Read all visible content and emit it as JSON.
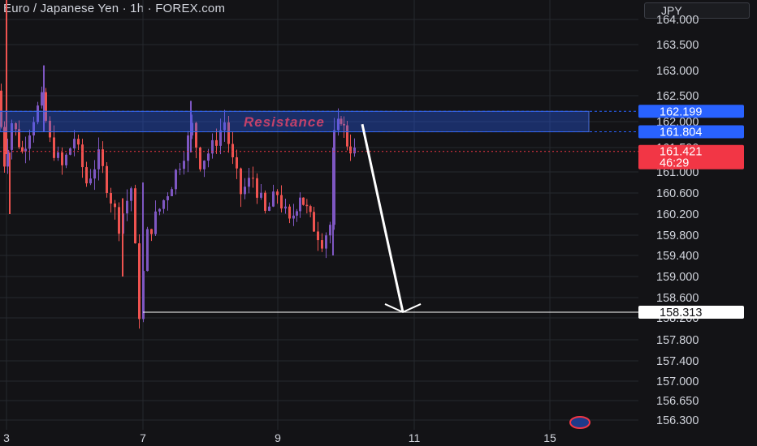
{
  "header": {
    "title": "Euro / Japanese Yen · 1h · FOREX.com",
    "currency_button": "JPY"
  },
  "colors": {
    "background": "#131316",
    "grid": "#26282e",
    "candle_up": "#7e57c2",
    "candle_down": "#ef5350",
    "resistance_zone": "#2962ff",
    "resistance_text": "#c2416a",
    "current_price": "#f23645",
    "target_line": "#ffffff"
  },
  "chart_data": {
    "type": "candlestick",
    "symbol": "EURJPY",
    "timeframe": "1h",
    "y_axis": {
      "ticks": [
        "164.000",
        "163.500",
        "163.000",
        "162.500",
        "162.000",
        "161.500",
        "161.000",
        "160.600",
        "160.200",
        "159.800",
        "159.400",
        "159.000",
        "158.600",
        "158.200",
        "157.800",
        "157.400",
        "157.000",
        "156.650",
        "156.300"
      ]
    },
    "x_axis": {
      "ticks": [
        "3",
        "7",
        "9",
        "11",
        "15"
      ]
    },
    "resistance_zone": {
      "label": "Resistance",
      "upper": 162.199,
      "lower": 161.804
    },
    "current_price": {
      "value": "161.421",
      "countdown": "46:29"
    },
    "target": {
      "value": "158.313"
    },
    "series_path": [
      [
        0,
        162.6
      ],
      [
        8,
        161.2
      ],
      [
        18,
        162.0
      ],
      [
        30,
        161.4
      ],
      [
        45,
        162.1
      ],
      [
        55,
        162.4
      ],
      [
        65,
        161.6
      ],
      [
        80,
        161.1
      ],
      [
        95,
        161.7
      ],
      [
        110,
        160.8
      ],
      [
        125,
        161.3
      ],
      [
        140,
        160.5
      ],
      [
        150,
        160.0
      ],
      [
        165,
        160.7
      ],
      [
        175,
        158.3
      ],
      [
        185,
        159.8
      ],
      [
        200,
        160.3
      ],
      [
        215,
        160.8
      ],
      [
        230,
        161.4
      ],
      [
        240,
        161.9
      ],
      [
        250,
        161.2
      ],
      [
        265,
        161.5
      ],
      [
        280,
        162.0
      ],
      [
        290,
        161.2
      ],
      [
        300,
        160.6
      ],
      [
        315,
        160.9
      ],
      [
        330,
        160.2
      ],
      [
        345,
        160.6
      ],
      [
        360,
        160.0
      ],
      [
        372,
        160.6
      ],
      [
        385,
        160.1
      ],
      [
        400,
        159.7
      ],
      [
        410,
        160.0
      ],
      [
        415,
        161.7
      ],
      [
        422,
        162.1
      ],
      [
        430,
        161.6
      ],
      [
        440,
        161.4
      ]
    ]
  }
}
